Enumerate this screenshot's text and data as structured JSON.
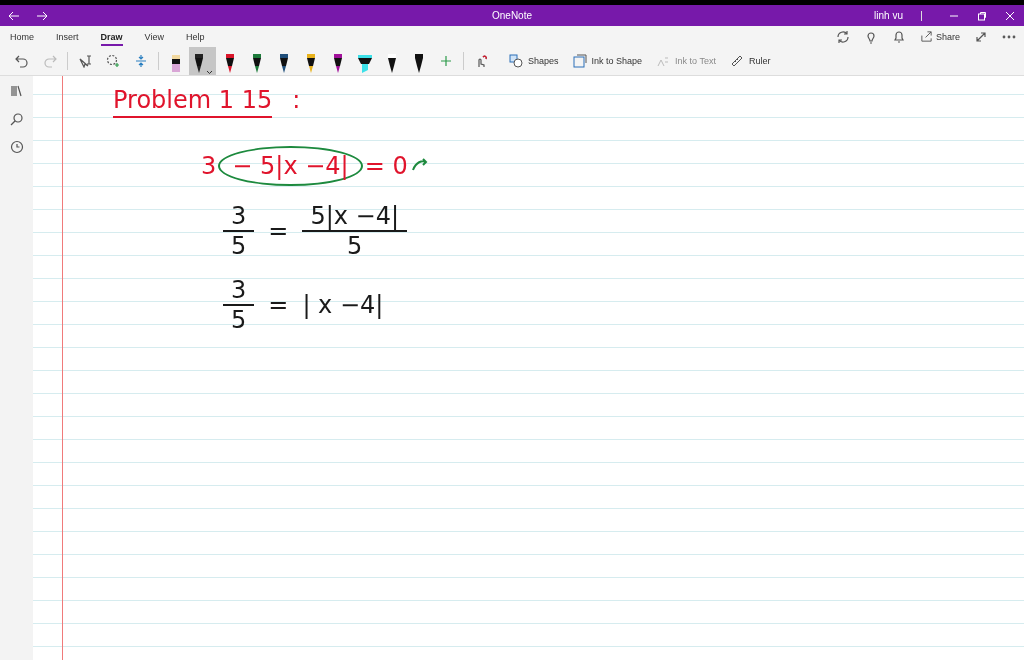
{
  "window": {
    "title": "OneNote",
    "user": "linh vu"
  },
  "tabs": [
    {
      "label": "Home",
      "selected": false
    },
    {
      "label": "Insert",
      "selected": false
    },
    {
      "label": "Draw",
      "selected": true
    },
    {
      "label": "View",
      "selected": false
    },
    {
      "label": "Help",
      "selected": false
    }
  ],
  "share": {
    "label": "Share"
  },
  "pens": [
    {
      "kind": "eraser",
      "color": "#d9a6d6",
      "selected": false
    },
    {
      "kind": "pen",
      "color": "#222222",
      "selected": true
    },
    {
      "kind": "pen",
      "color": "#d9152a",
      "selected": false
    },
    {
      "kind": "pen",
      "color": "#1d7a3a",
      "selected": false
    },
    {
      "kind": "pen",
      "color": "#1f4e7a",
      "selected": false
    },
    {
      "kind": "pen",
      "color": "#e8b21c",
      "selected": false
    },
    {
      "kind": "pen",
      "color": "#a1109a",
      "selected": false
    },
    {
      "kind": "highlighter",
      "color": "#3de0e8",
      "selected": false
    },
    {
      "kind": "pen",
      "color": "#ffffff",
      "selected": false
    },
    {
      "kind": "pen",
      "color": "#111111",
      "selected": false
    }
  ],
  "tools": [
    {
      "kind": "shapes",
      "label": "Shapes",
      "disabled": false
    },
    {
      "kind": "ink-to-shape",
      "label": "Ink to Shape",
      "disabled": false
    },
    {
      "kind": "ink-to-text",
      "label": "Ink to Text",
      "disabled": true
    },
    {
      "kind": "ruler",
      "label": "Ruler",
      "disabled": false
    }
  ],
  "ink": [
    {
      "kind": "heading",
      "text": "Problem 1 15",
      "suffix": ":",
      "color": "#e0142c"
    },
    {
      "kind": "equation",
      "color": "#e0142c",
      "circle": {
        "color": "#1d8a3e"
      },
      "parts": [
        {
          "text": "3",
          "circled": false
        },
        {
          "text": "− 5|x −4|",
          "circled": true
        },
        {
          "text": "= 0",
          "circled": false
        }
      ]
    },
    {
      "kind": "fractions",
      "color": "#1a1a1a",
      "left": {
        "num": "3",
        "den": "5"
      },
      "sign": "=",
      "right": {
        "num": "5|x −4|",
        "den": "5"
      }
    },
    {
      "kind": "fractions",
      "color": "#1a1a1a",
      "left": {
        "num": "3",
        "den": "5"
      },
      "sign": "=",
      "right": {
        "text": "| x −4|"
      }
    }
  ]
}
